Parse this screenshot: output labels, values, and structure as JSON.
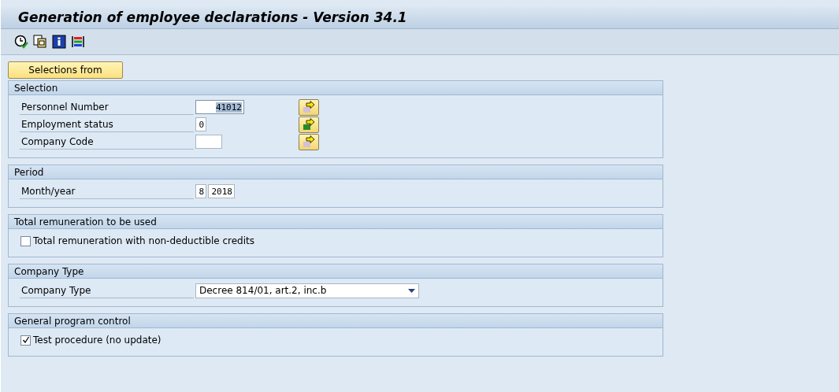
{
  "window": {
    "title": "Generation of employee declarations - Version 34.1"
  },
  "selections_button": "Selections from",
  "groups": [
    {
      "title": "Selection",
      "rows": [
        {
          "kind": "range",
          "label": "Personnel Number",
          "fields": [
            {
              "value": "41012",
              "highlighted": true
            }
          ],
          "multi_filled": false
        },
        {
          "kind": "range",
          "label": "Employment status",
          "fields": [
            {
              "value": "0",
              "highlighted": false
            }
          ],
          "multi_filled": true
        },
        {
          "kind": "range",
          "label": "Company Code",
          "fields": [
            {
              "highlighted": false
            }
          ],
          "multi_filled": false
        }
      ]
    },
    {
      "title": "Period",
      "rows": [
        {
          "kind": "fields",
          "label": "Month/year",
          "fields": [
            {
              "value": "8",
              "highlighted": false
            },
            {
              "value": "2018",
              "highlighted": false
            }
          ]
        }
      ]
    },
    {
      "title": "Total remuneration to be used",
      "rows": [
        {
          "kind": "checkbox",
          "label": "Total remuneration with non-deductible credits",
          "checked": false
        }
      ]
    },
    {
      "title": "Company Type",
      "rows": [
        {
          "kind": "dropdown",
          "label": "Company Type",
          "value": "Decree 814/01, art.2, inc.b"
        }
      ]
    },
    {
      "title": "General program control",
      "rows": [
        {
          "kind": "checkbox",
          "label": "Test procedure (no update)",
          "checked": true
        }
      ]
    }
  ]
}
